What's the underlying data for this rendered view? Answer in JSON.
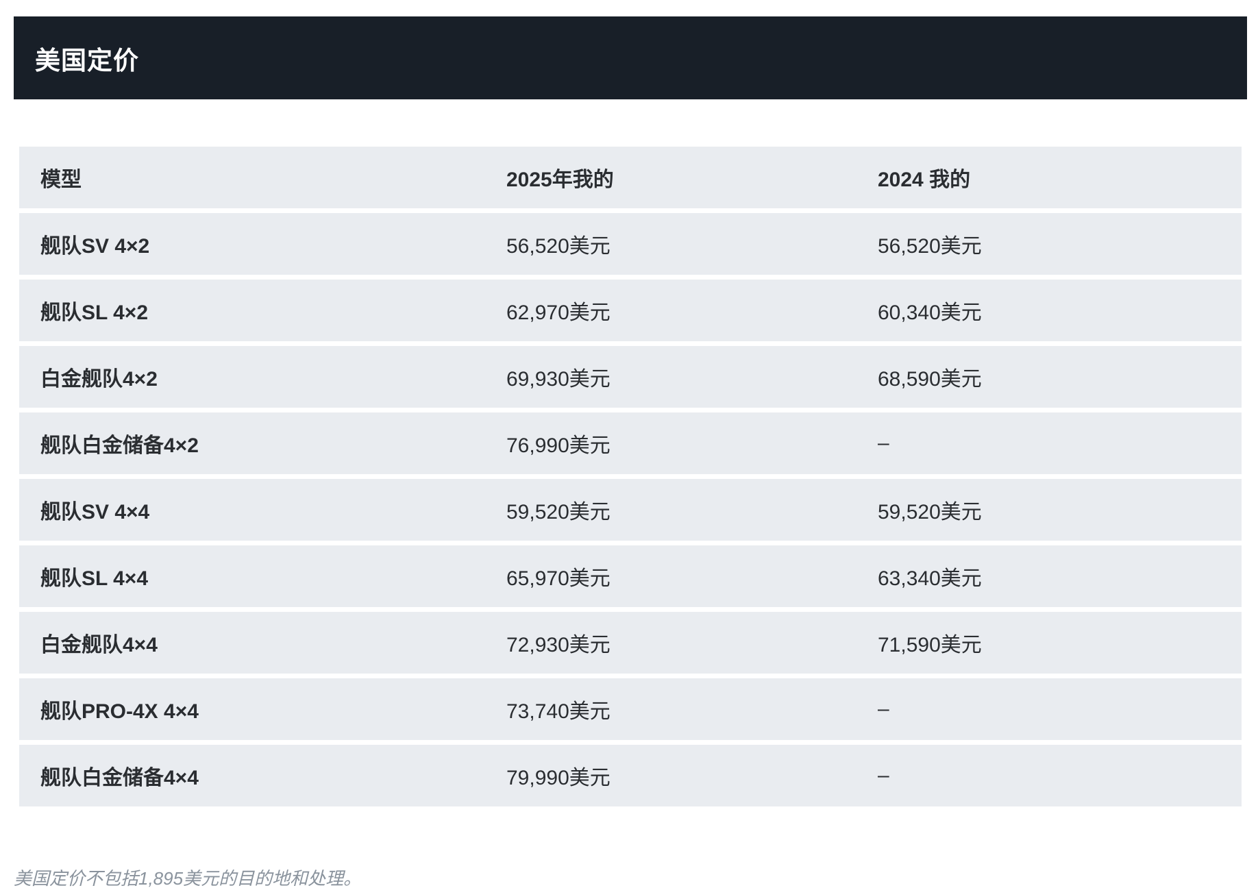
{
  "header": {
    "title": "美国定价"
  },
  "table": {
    "columns": [
      "模型",
      "2025年我的",
      "2024 我的"
    ],
    "rows": [
      {
        "model": "舰队SV 4×2",
        "price_2025": "56,520美元",
        "price_2024": "56,520美元"
      },
      {
        "model": "舰队SL 4×2",
        "price_2025": "62,970美元",
        "price_2024": "60,340美元"
      },
      {
        "model": "白金舰队4×2",
        "price_2025": "69,930美元",
        "price_2024": "68,590美元"
      },
      {
        "model": "舰队白金储备4×2",
        "price_2025": "76,990美元",
        "price_2024": "–"
      },
      {
        "model": "舰队SV 4×4",
        "price_2025": "59,520美元",
        "price_2024": "59,520美元"
      },
      {
        "model": "舰队SL 4×4",
        "price_2025": "65,970美元",
        "price_2024": "63,340美元"
      },
      {
        "model": "白金舰队4×4",
        "price_2025": "72,930美元",
        "price_2024": "71,590美元"
      },
      {
        "model": "舰队PRO-4X 4×4",
        "price_2025": "73,740美元",
        "price_2024": "–"
      },
      {
        "model": "舰队白金储备4×4",
        "price_2025": "79,990美元",
        "price_2024": "–"
      }
    ]
  },
  "footnote": "美国定价不包括1,895美元的目的地和处理。",
  "colors": {
    "header_bg": "#181f28",
    "row_bg": "#e9ecf0",
    "footnote_text": "#8a939d"
  }
}
